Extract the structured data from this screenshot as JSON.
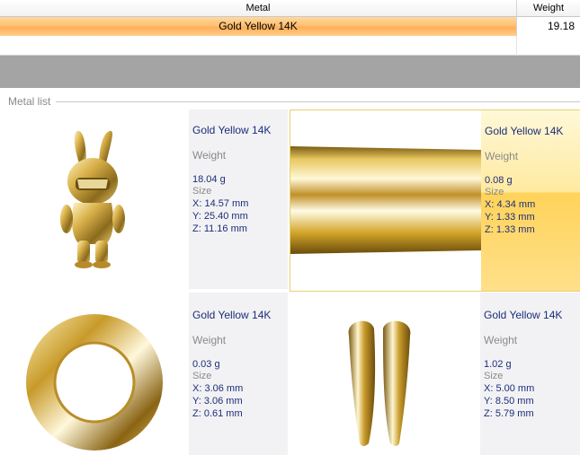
{
  "grid": {
    "columns": {
      "metal": "Metal",
      "weight": "Weight"
    },
    "row": {
      "metal": "Gold Yellow 14K",
      "weight": "19.18"
    }
  },
  "metal_list": {
    "title": "Metal list",
    "weight_label": "Weight",
    "size_label": "Size",
    "items": [
      {
        "name": "Gold Yellow 14K",
        "weight": "18.04 g",
        "x": "X: 14.57 mm",
        "y": "Y: 25.40 mm",
        "z": "Z: 11.16 mm",
        "icon": "bunny-figurine-icon"
      },
      {
        "name": "Gold Yellow 14K",
        "weight": "0.08 g",
        "x": "X: 4.34 mm",
        "y": "Y: 1.33 mm",
        "z": "Z: 1.33 mm",
        "icon": "gold-rod-icon"
      },
      {
        "name": "Gold Yellow 14K",
        "weight": "0.03 g",
        "x": "X: 3.06 mm",
        "y": "Y: 3.06 mm",
        "z": "Z: 0.61 mm",
        "icon": "gold-ring-icon"
      },
      {
        "name": "Gold Yellow 14K",
        "weight": "1.02 g",
        "x": "X: 5.00 mm",
        "y": "Y: 8.50 mm",
        "z": "Z: 5.79 mm",
        "icon": "gold-bail-icon"
      }
    ]
  },
  "colors": {
    "selected_row": "#ffbf70",
    "info_text": "#1c2d7a",
    "gold": "#d4a62a"
  }
}
